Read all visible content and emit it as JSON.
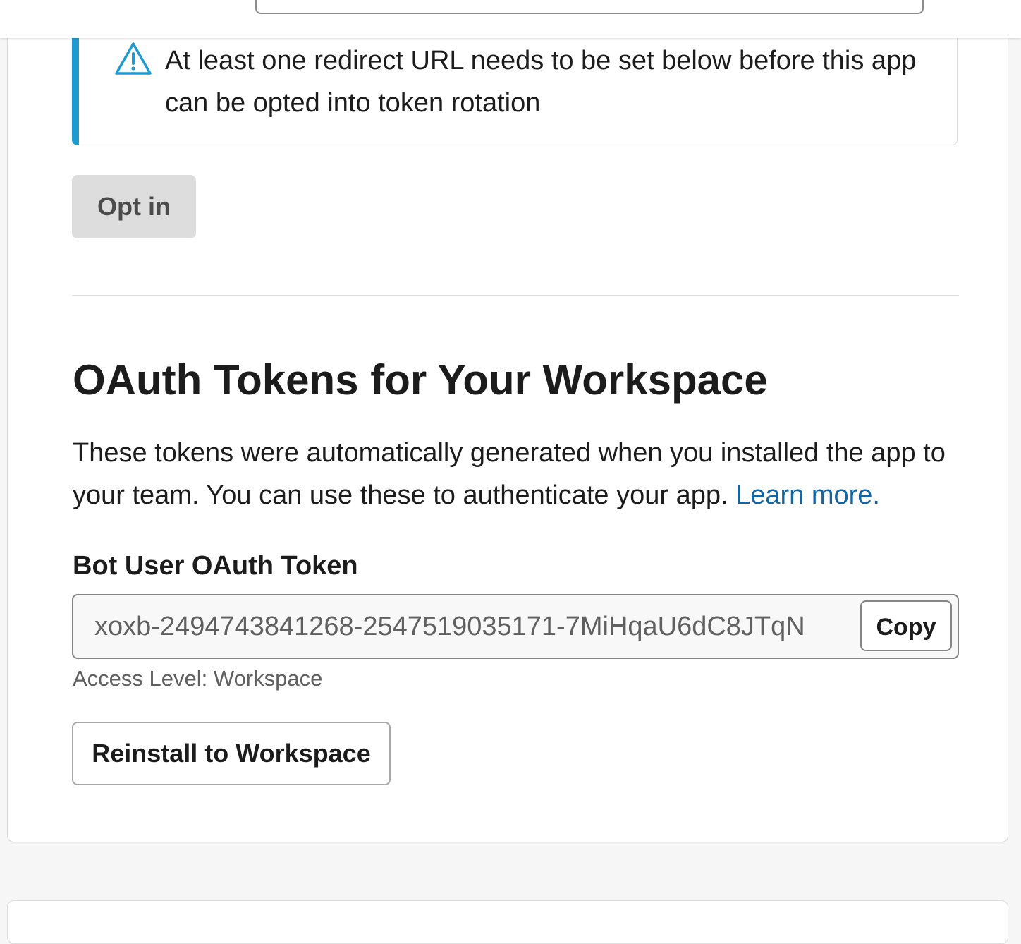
{
  "alert": {
    "icon": "warning-triangle-icon",
    "accent_color": "#1d9bd1",
    "message": "At least one redirect URL needs to be set below before this app can be opted into token rotation"
  },
  "rotation": {
    "opt_in_label": "Opt in"
  },
  "oauth": {
    "heading": "OAuth Tokens for Your Workspace",
    "description": "These tokens were automatically generated when you installed the app to your team. You can use these to authenticate your app.",
    "learn_more_label": "Learn more.",
    "link_color": "#1264a3",
    "bot_token": {
      "label": "Bot User OAuth Token",
      "value": "xoxb-2494743841268-2547519035171-7MiHqaU6dC8JTqN",
      "copy_label": "Copy",
      "access_level": "Access Level: Workspace"
    },
    "reinstall_label": "Reinstall to Workspace"
  }
}
